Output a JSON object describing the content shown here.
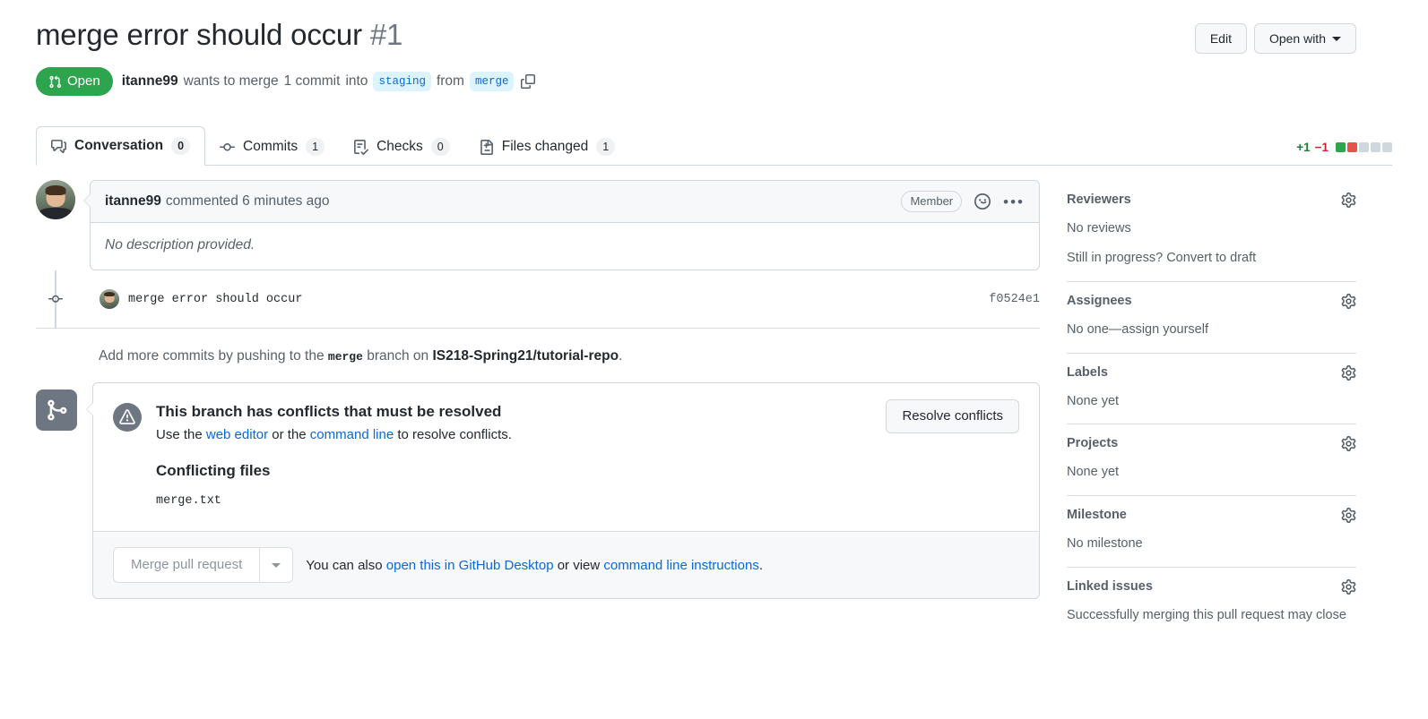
{
  "header": {
    "title": "merge error should occur",
    "number": "#1",
    "state": "Open",
    "author": "itanne99",
    "merge_text_1": "wants to merge",
    "commit_count_text": "1 commit",
    "merge_text_2": "into",
    "base_branch": "staging",
    "from_text": "from",
    "head_branch": "merge",
    "edit_label": "Edit",
    "open_with_label": "Open with"
  },
  "tabs": [
    {
      "label": "Conversation",
      "count": "0",
      "icon": "comment-icon",
      "active": true
    },
    {
      "label": "Commits",
      "count": "1",
      "icon": "commit-icon",
      "active": false
    },
    {
      "label": "Checks",
      "count": "0",
      "icon": "checklist-icon",
      "active": false
    },
    {
      "label": "Files changed",
      "count": "1",
      "icon": "file-diff-icon",
      "active": false
    }
  ],
  "diffstat": {
    "additions": "+1",
    "deletions": "−1",
    "blocks": [
      "g",
      "r",
      "n",
      "n",
      "n"
    ]
  },
  "comment": {
    "author": "itanne99",
    "action": "commented 6 minutes ago",
    "badge": "Member",
    "body": "No description provided."
  },
  "commit": {
    "message": "merge error should occur",
    "sha": "f0524e1"
  },
  "add_commits": {
    "prefix": "Add more commits by pushing to the",
    "branch": "merge",
    "middle": "branch on",
    "repo": "IS218-Spring21/tutorial-repo",
    "suffix": "."
  },
  "merge_box": {
    "conflict_title": "This branch has conflicts that must be resolved",
    "sub_prefix": "Use the",
    "web_editor_link": "web editor",
    "sub_middle": "or the",
    "command_line_link": "command line",
    "sub_suffix": "to resolve conflicts.",
    "resolve_label": "Resolve conflicts",
    "conflicting_files_title": "Conflicting files",
    "files": [
      "merge.txt"
    ],
    "merge_button_label": "Merge pull request",
    "footer_prefix": "You can also",
    "footer_link_1": "open this in GitHub Desktop",
    "footer_middle": "or view",
    "footer_link_2": "command line instructions",
    "footer_suffix": "."
  },
  "sidebar": [
    {
      "title": "Reviewers",
      "lines": [
        "No reviews",
        "Still in progress? Convert to draft"
      ]
    },
    {
      "title": "Assignees",
      "lines": [
        "No one—assign yourself"
      ]
    },
    {
      "title": "Labels",
      "lines": [
        "None yet"
      ]
    },
    {
      "title": "Projects",
      "lines": [
        "None yet"
      ]
    },
    {
      "title": "Milestone",
      "lines": [
        "No milestone"
      ]
    },
    {
      "title": "Linked issues",
      "lines": [
        "Successfully merging this pull request may close"
      ]
    }
  ],
  "colors": {
    "open_green": "#2da44e",
    "link_blue": "#0969da",
    "addition": "#1a7f37",
    "deletion": "#cf222e",
    "border": "#d0d7de"
  }
}
